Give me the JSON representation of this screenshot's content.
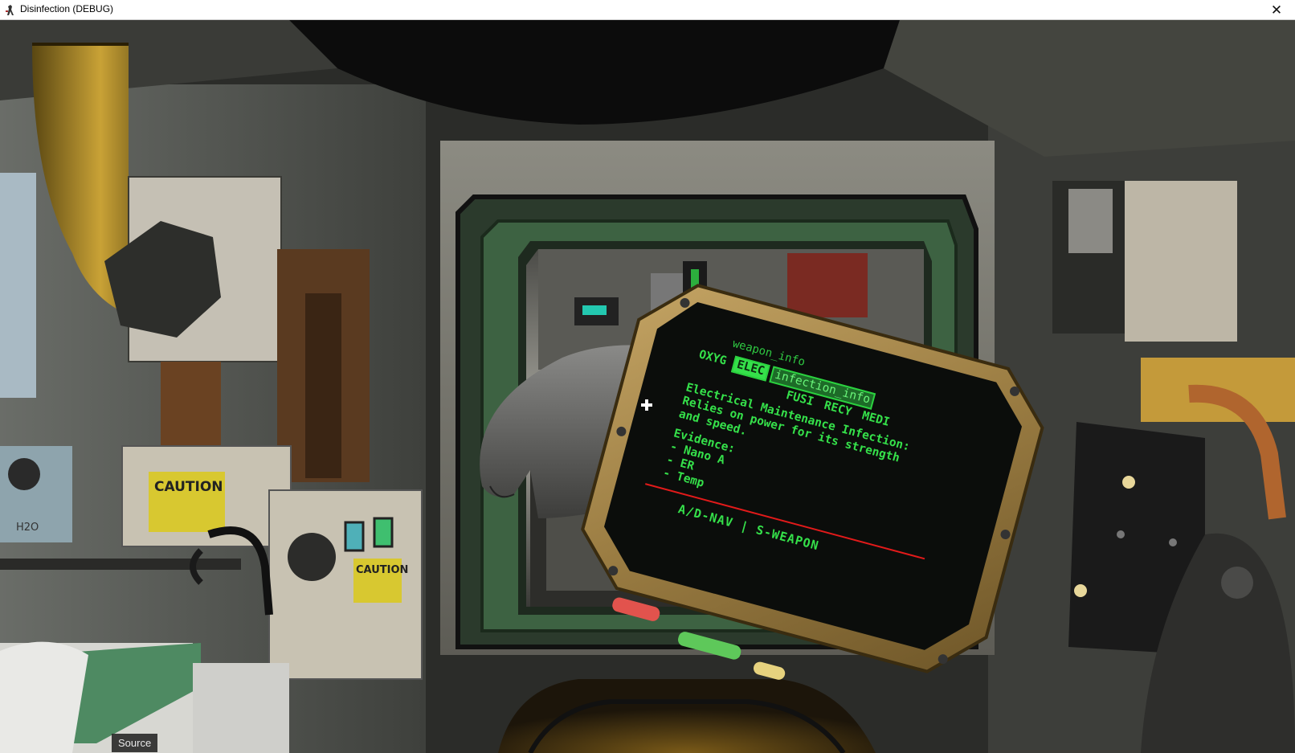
{
  "window": {
    "title": "Disinfection (DEBUG)",
    "close_glyph": "✕",
    "icon": "game-app-icon"
  },
  "device": {
    "header_tab": "weapon_info",
    "tabs": [
      {
        "label": "OXYG",
        "active": false
      },
      {
        "label": "ELEC",
        "active": true
      },
      {
        "label": "FUSI",
        "active": false
      },
      {
        "label": "RECY",
        "active": false
      },
      {
        "label": "MEDI",
        "active": false
      }
    ],
    "info_tab": "infection_info",
    "description": [
      "Electrical Maintenance Infection:",
      "Relies on power for its strength",
      "and speed."
    ],
    "evidence_title": "Evidence:",
    "evidence": [
      "- Nano A",
      "- ER",
      "- Temp"
    ],
    "footer": "A/D-NAV | S-WEAPON"
  },
  "wall_labels": {
    "caution_1": "CAUTION",
    "caution_2": "CAUTION",
    "h2o": "H2O"
  },
  "overlay": {
    "source_label": "Source"
  },
  "colors": {
    "screen_text": "#35e04a",
    "screen_border": "#2bd13f",
    "footer_line": "#e21a1a",
    "device_frame": "#a88a4c"
  }
}
